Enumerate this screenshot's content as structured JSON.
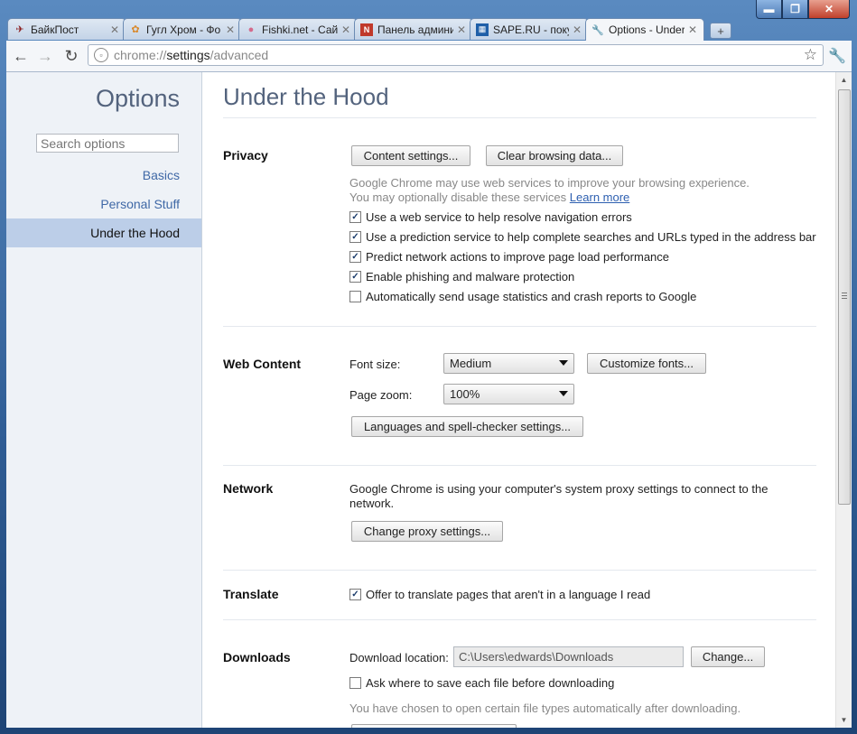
{
  "tabs": [
    {
      "title": "БайкПост",
      "icon": "bike-favicon"
    },
    {
      "title": "Гугл Хром - Фо",
      "icon": "chrome-favicon"
    },
    {
      "title": "Fishki.net - Сай",
      "icon": "pig-favicon"
    },
    {
      "title": "Панель админи",
      "icon": "admin-favicon"
    },
    {
      "title": "SAPE.RU - покуп",
      "icon": "sape-favicon"
    },
    {
      "title": "Options - Under",
      "icon": "wrench-favicon"
    }
  ],
  "window_controls": {
    "minimize": "▬",
    "maximize": "❐",
    "close": "✕"
  },
  "toolbar": {
    "url_scheme": "chrome://",
    "url_host": "settings",
    "url_path": "/advanced"
  },
  "sidebar": {
    "title": "Options",
    "search_placeholder": "Search options",
    "items": [
      {
        "label": "Basics"
      },
      {
        "label": "Personal Stuff"
      },
      {
        "label": "Under the Hood",
        "selected": true
      }
    ]
  },
  "page": {
    "title": "Under the Hood",
    "privacy": {
      "title": "Privacy",
      "content_settings": "Content settings...",
      "clear_data": "Clear browsing data...",
      "desc1": "Google Chrome may use web services to improve your browsing experience.",
      "desc2": "You may optionally disable these services",
      "learn_more": "Learn more",
      "checkboxes": [
        {
          "label": "Use a web service to help resolve navigation errors",
          "checked": true
        },
        {
          "label": "Use a prediction service to help complete searches and URLs typed in the address bar",
          "checked": true
        },
        {
          "label": "Predict network actions to improve page load performance",
          "checked": true
        },
        {
          "label": "Enable phishing and malware protection",
          "checked": true
        },
        {
          "label": "Automatically send usage statistics and crash reports to Google",
          "checked": false
        }
      ]
    },
    "web_content": {
      "title": "Web Content",
      "font_size_label": "Font size:",
      "font_size_value": "Medium",
      "customize_fonts": "Customize fonts...",
      "page_zoom_label": "Page zoom:",
      "page_zoom_value": "100%",
      "languages": "Languages and spell-checker settings..."
    },
    "network": {
      "title": "Network",
      "desc_line1": "Google Chrome is using your computer's system proxy settings to connect to the",
      "desc_line2": "network.",
      "change_proxy": "Change proxy settings..."
    },
    "translate": {
      "title": "Translate",
      "offer": "Offer to translate pages that aren't in a language I read",
      "checked": true
    },
    "downloads": {
      "title": "Downloads",
      "location_label": "Download location:",
      "location_value": "C:\\Users\\edwards\\Downloads",
      "change": "Change...",
      "ask_where": "Ask where to save each file before downloading",
      "ask_checked": false,
      "auto_open_note": "You have chosen to open certain file types automatically after downloading."
    }
  }
}
